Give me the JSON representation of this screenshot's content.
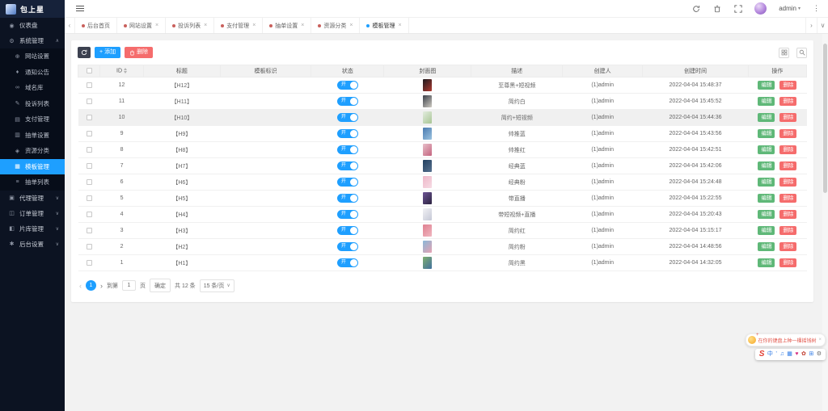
{
  "colors": {
    "accent": "#1E9FFF",
    "success": "#5FB878",
    "danger": "#f56c6c",
    "sidebar_bg": "#0c1322",
    "tab_dot_inactive": "#c9605c"
  },
  "header": {
    "username": "admin"
  },
  "sidebar": {
    "logo": "包上星",
    "dashboard_label": "仪表盘",
    "dashboard_icon": "◉",
    "system": {
      "icon": "⚙",
      "label": "系统管理",
      "children": [
        {
          "icon": "⊕",
          "label": "网站设置",
          "active": false
        },
        {
          "icon": "♦",
          "label": "通知公告",
          "active": false
        },
        {
          "icon": "∞",
          "label": "域名库",
          "active": false
        },
        {
          "icon": "✎",
          "label": "投诉列表",
          "active": false
        },
        {
          "icon": "▤",
          "label": "支付管理",
          "active": false
        },
        {
          "icon": "▥",
          "label": "抽单设置",
          "active": false
        },
        {
          "icon": "◈",
          "label": "资源分类",
          "active": false
        },
        {
          "icon": "▦",
          "label": "模板管理",
          "active": true
        },
        {
          "icon": "≡",
          "label": "抽单列表",
          "active": false
        }
      ]
    },
    "groups": [
      {
        "icon": "▣",
        "label": "代理管理"
      },
      {
        "icon": "◫",
        "label": "订单管理"
      },
      {
        "icon": "◧",
        "label": "片库管理"
      },
      {
        "icon": "✱",
        "label": "后台设置"
      }
    ]
  },
  "tabs": [
    {
      "label": "后台首页",
      "closable": false,
      "active": false
    },
    {
      "label": "网站设置",
      "closable": true,
      "active": false
    },
    {
      "label": "投诉列表",
      "closable": true,
      "active": false
    },
    {
      "label": "支付管理",
      "closable": true,
      "active": false
    },
    {
      "label": "抽单设置",
      "closable": true,
      "active": false
    },
    {
      "label": "资源分类",
      "closable": true,
      "active": false
    },
    {
      "label": "模板管理",
      "closable": true,
      "active": true
    }
  ],
  "toolbar": {
    "add_label": "添加",
    "delete_label": "删除"
  },
  "table": {
    "headers": [
      "ID",
      "标题",
      "模板标识",
      "状态",
      "封面图",
      "描述",
      "创建人",
      "创建时间",
      "操作"
    ],
    "on_label": "开",
    "edit_label": "编辑",
    "delete_label": "删除",
    "rows": [
      {
        "id": "12",
        "title": "【H12】",
        "identifier": "",
        "status": "开",
        "desc": "至尊黑+短视频",
        "creator": "(1)admin",
        "created": "2022-04-04 15:48:37",
        "cover": [
          "#1b1b20",
          "#b03a30"
        ],
        "highlight": false
      },
      {
        "id": "11",
        "title": "【H11】",
        "identifier": "",
        "status": "开",
        "desc": "简约白",
        "creator": "(1)admin",
        "created": "2022-04-04 15:45:52",
        "cover": [
          "#3a3f48",
          "#cfcbc2"
        ],
        "highlight": false
      },
      {
        "id": "10",
        "title": "【H10】",
        "identifier": "",
        "status": "开",
        "desc": "简约+短视频",
        "creator": "(1)admin",
        "created": "2022-04-04 15:44:36",
        "cover": [
          "#e3ecdf",
          "#a8c594"
        ],
        "highlight": true
      },
      {
        "id": "9",
        "title": "【H9】",
        "identifier": "",
        "status": "开",
        "desc": "帅推蓝",
        "creator": "(1)admin",
        "created": "2022-04-04 15:43:56",
        "cover": [
          "#4a7ab0",
          "#9cc3e0"
        ],
        "highlight": false
      },
      {
        "id": "8",
        "title": "【H8】",
        "identifier": "",
        "status": "开",
        "desc": "帅推红",
        "creator": "(1)admin",
        "created": "2022-04-04 15:42:51",
        "cover": [
          "#e7bfc9",
          "#c4647f"
        ],
        "highlight": false
      },
      {
        "id": "7",
        "title": "【H7】",
        "identifier": "",
        "status": "开",
        "desc": "经典蓝",
        "creator": "(1)admin",
        "created": "2022-04-04 15:42:06",
        "cover": [
          "#23405f",
          "#57718f"
        ],
        "highlight": false
      },
      {
        "id": "6",
        "title": "【H6】",
        "identifier": "",
        "status": "开",
        "desc": "经典粉",
        "creator": "(1)admin",
        "created": "2022-04-04 15:24:48",
        "cover": [
          "#eeb7c8",
          "#f6dbe4"
        ],
        "highlight": false
      },
      {
        "id": "5",
        "title": "【H5】",
        "identifier": "",
        "status": "开",
        "desc": "带直播",
        "creator": "(1)admin",
        "created": "2022-04-04 15:22:55",
        "cover": [
          "#6d5494",
          "#2c2340"
        ],
        "highlight": false
      },
      {
        "id": "4",
        "title": "【H4】",
        "identifier": "",
        "status": "开",
        "desc": "带短视频+直播",
        "creator": "(1)admin",
        "created": "2022-04-04 15:20:43",
        "cover": [
          "#f1f1f4",
          "#c5c8d6"
        ],
        "highlight": false
      },
      {
        "id": "3",
        "title": "【H3】",
        "identifier": "",
        "status": "开",
        "desc": "简约红",
        "creator": "(1)admin",
        "created": "2022-04-04 15:15:17",
        "cover": [
          "#df8090",
          "#f0b6c0"
        ],
        "highlight": false
      },
      {
        "id": "2",
        "title": "【H2】",
        "identifier": "",
        "status": "开",
        "desc": "简约粉",
        "creator": "(1)admin",
        "created": "2022-04-04 14:48:56",
        "cover": [
          "#8ab8d8",
          "#e6a2b2"
        ],
        "highlight": false
      },
      {
        "id": "1",
        "title": "【H1】",
        "identifier": "",
        "status": "开",
        "desc": "简约黑",
        "creator": "(1)admin",
        "created": "2022-04-04 14:32:05",
        "cover": [
          "#7fae6e",
          "#41709e"
        ],
        "highlight": false
      }
    ]
  },
  "pagination": {
    "prev": "‹",
    "current_page": "1",
    "next": "›",
    "goto_label": "到第",
    "goto_value": "1",
    "page_unit": "页",
    "confirm_label": "确定",
    "total_label": "共 12 条",
    "page_size": "15 条/页"
  },
  "ime": {
    "bubble_text": "在你的键盘上种一棵摇钱树",
    "close": "×",
    "logo": "S",
    "icons": [
      {
        "name": "chinese-mode-icon",
        "glyph": "中",
        "color": "#2f7ae5"
      },
      {
        "name": "punctuation-icon",
        "glyph": "’",
        "color": "#2f7ae5"
      },
      {
        "name": "voice-input-icon",
        "glyph": "♫",
        "color": "#2f7ae5"
      },
      {
        "name": "soft-keyboard-icon",
        "glyph": "▦",
        "color": "#2f7ae5"
      },
      {
        "name": "favorite-icon",
        "glyph": "♥",
        "color": "#d63384"
      },
      {
        "name": "skin-icon",
        "glyph": "✿",
        "color": "#c0392b"
      },
      {
        "name": "toolbox-icon",
        "glyph": "⊞",
        "color": "#2f7ae5"
      },
      {
        "name": "settings-icon",
        "glyph": "⚙",
        "color": "#666666"
      }
    ]
  }
}
